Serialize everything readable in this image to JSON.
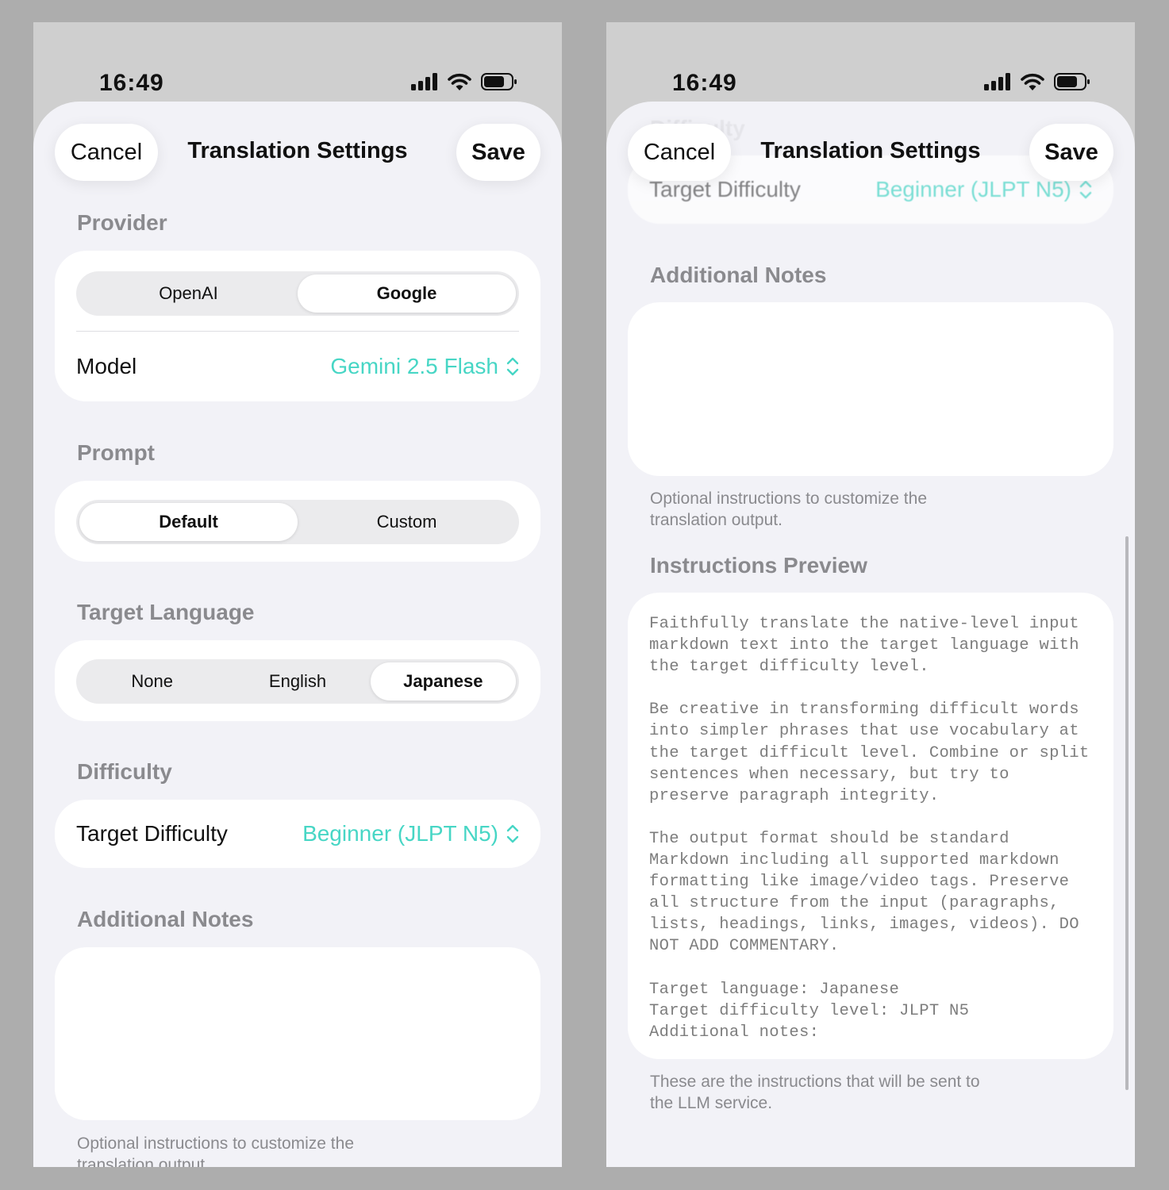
{
  "status": {
    "time": "16:49"
  },
  "nav": {
    "cancel": "Cancel",
    "title": "Translation Settings",
    "save": "Save"
  },
  "provider": {
    "title": "Provider",
    "options": [
      "OpenAI",
      "Google"
    ],
    "selected": "Google",
    "model_label": "Model",
    "model_value": "Gemini 2.5 Flash"
  },
  "prompt": {
    "title": "Prompt",
    "options": [
      "Default",
      "Custom"
    ],
    "selected": "Default"
  },
  "target_language": {
    "title": "Target Language",
    "options": [
      "None",
      "English",
      "Japanese"
    ],
    "selected": "Japanese"
  },
  "difficulty": {
    "title": "Difficulty",
    "label": "Target Difficulty",
    "value": "Beginner (JLPT N5)"
  },
  "additional_notes": {
    "title": "Additional Notes",
    "value": "",
    "footnote": "Optional instructions to customize the translation output."
  },
  "instructions_preview": {
    "title": "Instructions Preview",
    "text": "Faithfully translate the native-level input\nmarkdown text into the target language with\nthe target difficulty level.\n\nBe creative in transforming difficult words\ninto simpler phrases that use vocabulary at\nthe target difficult level. Combine or split\nsentences when necessary, but try to\npreserve paragraph integrity.\n\nThe output format should be standard\nMarkdown including all supported markdown\nformatting like image/video tags. Preserve\nall structure from the input (paragraphs,\nlists, headings, links, images, videos). DO\nNOT ADD COMMENTARY.\n\nTarget language: Japanese\nTarget difficulty level: JLPT N5\nAdditional notes:",
    "footnote": "These are the instructions that will be sent to the LLM service."
  },
  "colors": {
    "accent": "#47d6c5",
    "sheet_bg": "#f2f2f7",
    "section_title": "#8a8a8e"
  },
  "icons": [
    "cellular-signal-icon",
    "wifi-icon",
    "battery-icon",
    "chevron-up-down-icon"
  ]
}
